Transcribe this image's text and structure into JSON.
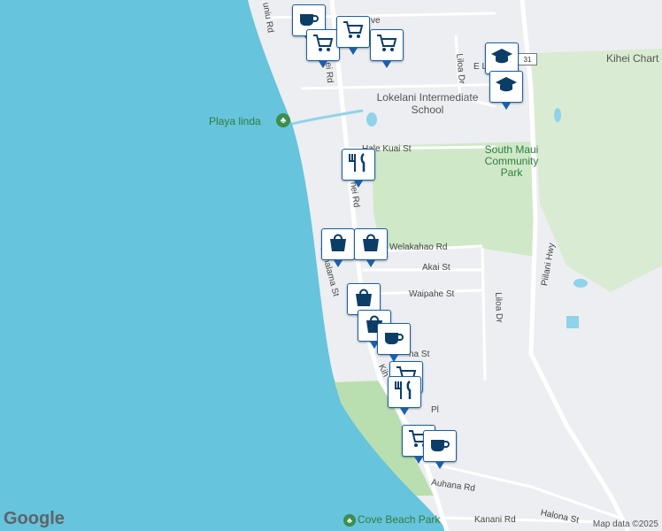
{
  "map": {
    "roads": {
      "s_kihei_rd_north": "ei Rd",
      "s_kihei_rd_mid": "hei Rd",
      "s_kihei_rd_south": "Kih",
      "uluniu_rd": "uniu Rd",
      "hale_kuai_st": "Hale Kuai St",
      "welakahao_rd": "Welakahao Rd",
      "akai_st": "Akai St",
      "waipahe_st": "Waipahe St",
      "liloa_dr_north": "Liloa Dr",
      "liloa_dr_south": "Liloa Dr",
      "kuhalama_st": "Kuhalama St",
      "auhana_rd": "Auhana Rd",
      "kanani_rd": "Kanani Rd",
      "halona_st": "Halona St",
      "piilani_hwy": "Piilani Hwy",
      "e_lipoa": "E Li",
      "ave": "ve",
      "na_st": "na St",
      "pl": "Pl",
      "hwy_shield": "31"
    },
    "pois": {
      "playa_linda": "Playa linda",
      "lokelani": "Lokelani Intermediate School",
      "south_maui_park": "South Maui Community Park",
      "kihei_charter": "Kihei Chart",
      "cove_beach_park": "Cove Beach Park"
    },
    "attribution": {
      "logo": "Google",
      "map_data": "Map data ©2025"
    },
    "markers": [
      {
        "icon": "coffee-icon"
      },
      {
        "icon": "shopping-cart-icon"
      },
      {
        "icon": "shopping-cart-icon"
      },
      {
        "icon": "shopping-cart-icon"
      },
      {
        "icon": "school-icon"
      },
      {
        "icon": "school-icon"
      },
      {
        "icon": "restaurant-icon"
      },
      {
        "icon": "shopping-bag-icon"
      },
      {
        "icon": "shopping-bag-icon"
      },
      {
        "icon": "shopping-bag-icon"
      },
      {
        "icon": "shopping-bag-icon"
      },
      {
        "icon": "coffee-icon"
      },
      {
        "icon": "shopping-cart-icon"
      },
      {
        "icon": "restaurant-icon"
      },
      {
        "icon": "shopping-cart-icon"
      },
      {
        "icon": "coffee-icon"
      }
    ]
  }
}
